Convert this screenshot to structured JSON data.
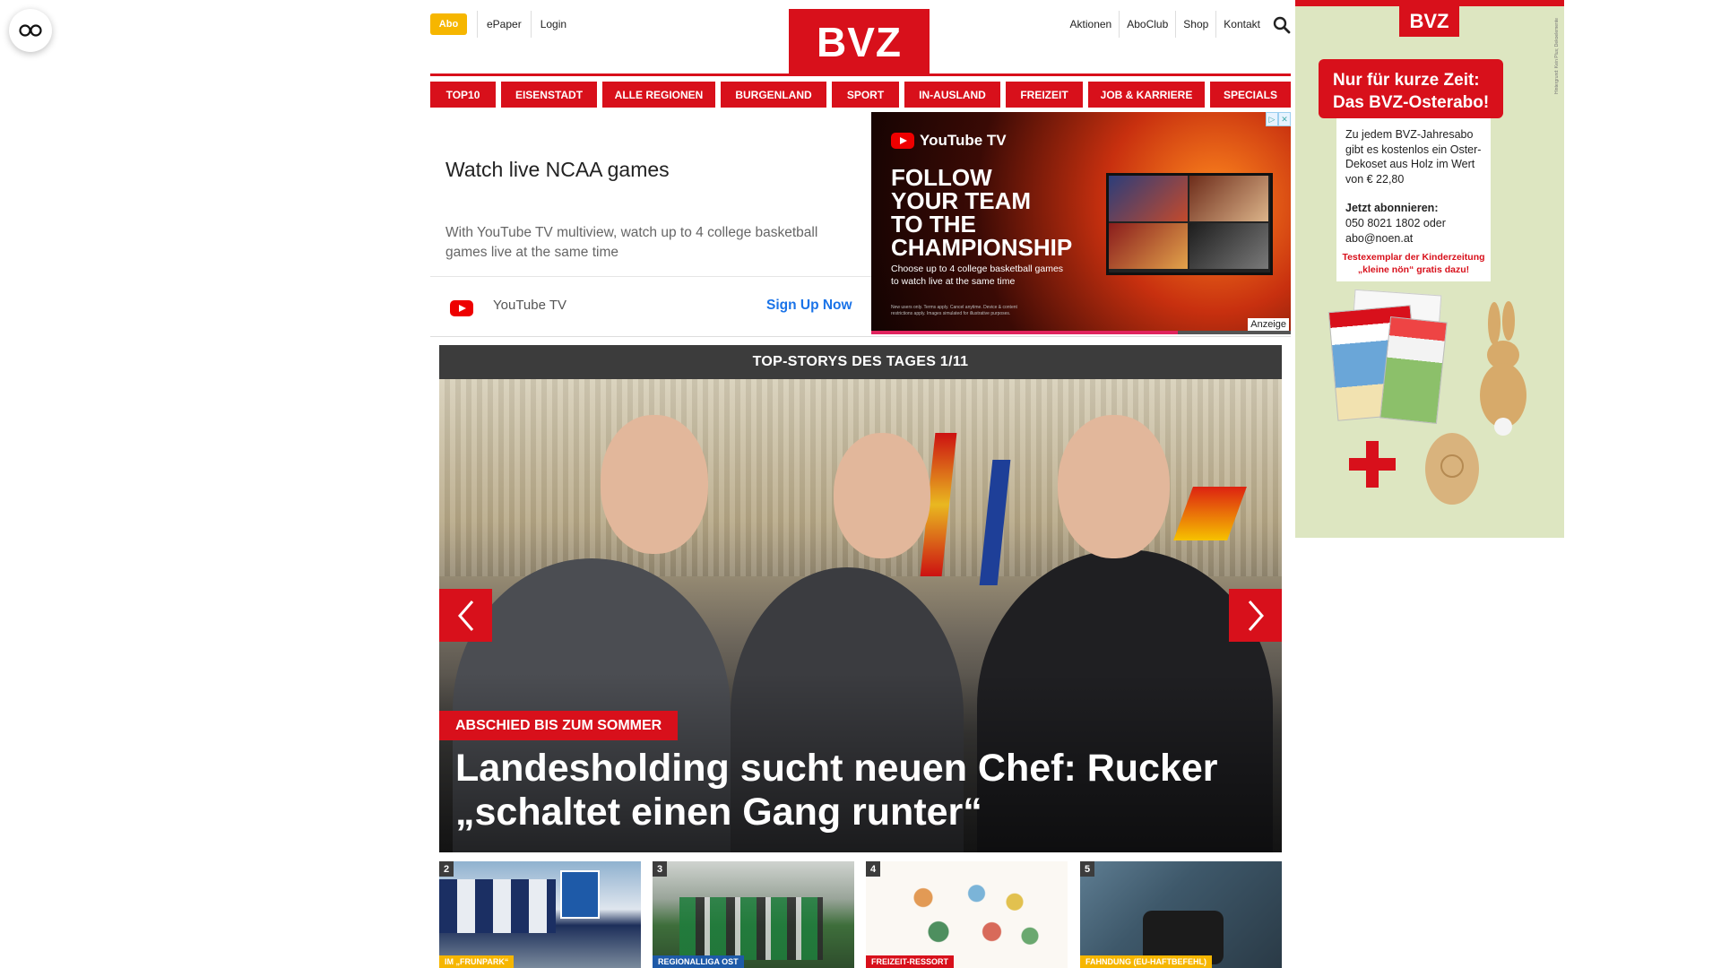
{
  "header": {
    "abo": "Abo",
    "links_left": [
      "ePaper",
      "Login"
    ],
    "links_right": [
      "Aktionen",
      "AboClub",
      "Shop",
      "Kontakt"
    ],
    "logo": "BVZ"
  },
  "nav": [
    "TOP10",
    "EISENSTADT",
    "ALLE REGIONEN",
    "BURGENLAND",
    "SPORT",
    "IN-AUSLAND",
    "FREIZEIT",
    "JOB & KARRIERE",
    "SPECIALS"
  ],
  "ad": {
    "headline": "Watch live NCAA games",
    "description": "With YouTube TV multiview, watch up to 4 college basketball games live at the same time",
    "brand": "YouTube TV",
    "cta": "Sign Up Now",
    "image_brand": "YouTube TV",
    "image_headline": [
      "FOLLOW",
      "YOUR TEAM",
      "TO THE",
      "CHAMPIONSHIP"
    ],
    "image_sub": "Choose up to 4 college basketball games to watch live at the same time",
    "image_fine": "New users only. Terms apply. Cancel anytime. Device & content restrictions apply. Images simulated for illustrative purposes.",
    "label": "Anzeige",
    "progress": 0.73
  },
  "stories": {
    "header": "TOP-STORYS DES TAGES 1/11",
    "hero": {
      "kicker": "ABSCHIED BIS ZUM SOMMER",
      "title_line1": "Landesholding sucht neuen Chef: Rucker",
      "title_line2": "„schaltet einen Gang runter“"
    },
    "thumbs": [
      {
        "num": "2",
        "category": "IM „FRUNPARK“",
        "cat_color": "#f6b600"
      },
      {
        "num": "3",
        "category": "REGIONALLIGA OST",
        "cat_color": "#1e5aa8"
      },
      {
        "num": "4",
        "category": "FREIZEIT-RESSORT",
        "cat_color": "#d8101b"
      },
      {
        "num": "5",
        "category": "FAHNDUNG (EU-HAFTBEFEHL)",
        "cat_color": "#f6b600"
      }
    ]
  },
  "side_ad": {
    "logo": "BVZ",
    "banner_line1": "Nur für kurze Zeit:",
    "banner_line2": "Das BVZ-Osterabo!",
    "text1": "Zu jedem BVZ-Jahresabo gibt es kostenlos ein Oster-Dekoset aus Holz im Wert von € 22,80",
    "text2_title": "Jetzt abonnieren:",
    "text2": "050 8021 1802 oder abo@noen.at",
    "red_note": "Testexemplar der Kinderzeitung „kleine nön“ gratis dazu!",
    "vertical": "Hintergrund: Kein Plus; Dekoelemente"
  }
}
